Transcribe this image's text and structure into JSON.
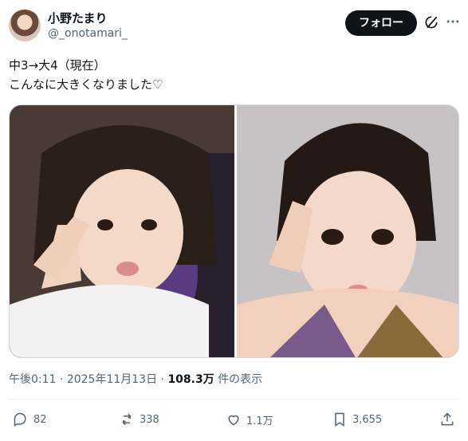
{
  "user": {
    "display_name": "小野たまり",
    "handle": "@_onotamari_"
  },
  "follow_label": "フォロー",
  "tweet": {
    "line1": "中3→大4（現在）",
    "line2": "こんなに大きくなりました♡"
  },
  "media": {
    "count": 2
  },
  "meta": {
    "time": "午後0:11",
    "date": "2025年11月13日",
    "views": "108.3万",
    "views_label": "件の表示"
  },
  "actions": {
    "replies": "82",
    "reposts": "338",
    "likes": "1.1万",
    "bookmarks": "3,655"
  },
  "icons": [
    "avatar",
    "grok-icon",
    "more-icon",
    "reply-icon",
    "repost-icon",
    "like-icon",
    "bookmark-icon",
    "share-icon"
  ]
}
